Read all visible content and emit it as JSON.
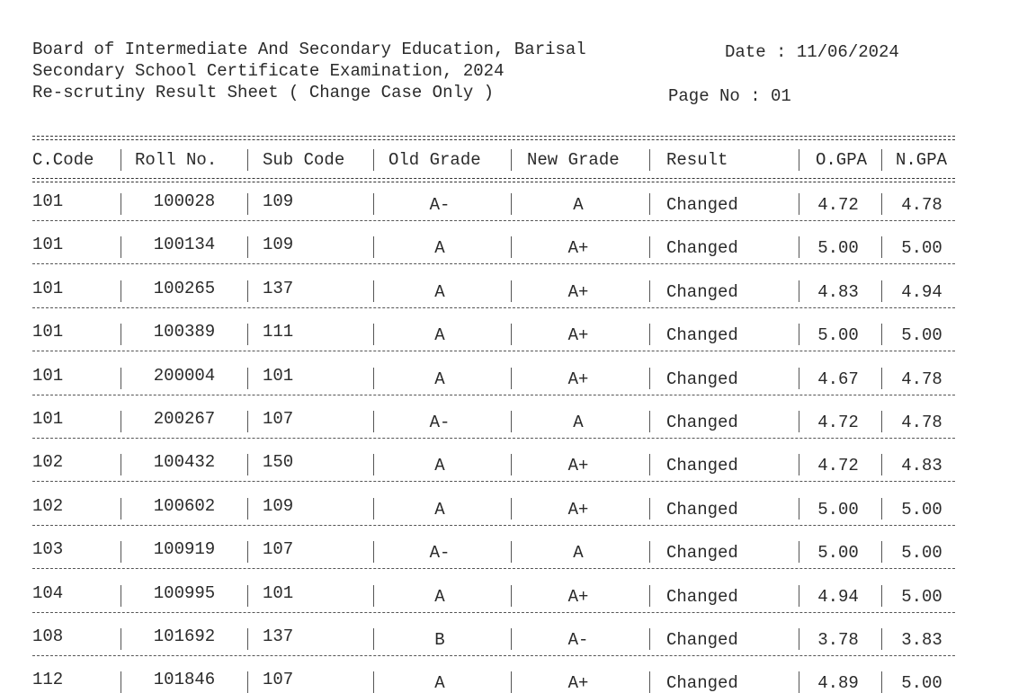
{
  "header": {
    "board": "Board of Intermediate And Secondary Education, Barisal",
    "exam": "Secondary School Certificate Examination, 2024",
    "sheet_title": "Re-scrutiny Result Sheet ( Change Case Only )",
    "date_label": "Date : 11/06/2024",
    "page_label": "Page No : 01"
  },
  "table": {
    "columns": [
      "C.Code",
      "Roll No.",
      "Sub Code",
      "Old Grade",
      "New Grade",
      "Result",
      "O.GPA",
      "N.GPA"
    ],
    "rows": [
      {
        "ccode": "101",
        "roll": "100028",
        "sub": "109",
        "old": "A-",
        "new": "A",
        "result": "Changed",
        "ogpa": "4.72",
        "ngpa": "4.78"
      },
      {
        "ccode": "101",
        "roll": "100134",
        "sub": "109",
        "old": "A",
        "new": "A+",
        "result": "Changed",
        "ogpa": "5.00",
        "ngpa": "5.00"
      },
      {
        "ccode": "101",
        "roll": "100265",
        "sub": "137",
        "old": "A",
        "new": "A+",
        "result": "Changed",
        "ogpa": "4.83",
        "ngpa": "4.94"
      },
      {
        "ccode": "101",
        "roll": "100389",
        "sub": "111",
        "old": "A",
        "new": "A+",
        "result": "Changed",
        "ogpa": "5.00",
        "ngpa": "5.00"
      },
      {
        "ccode": "101",
        "roll": "200004",
        "sub": "101",
        "old": "A",
        "new": "A+",
        "result": "Changed",
        "ogpa": "4.67",
        "ngpa": "4.78"
      },
      {
        "ccode": "101",
        "roll": "200267",
        "sub": "107",
        "old": "A-",
        "new": "A",
        "result": "Changed",
        "ogpa": "4.72",
        "ngpa": "4.78"
      },
      {
        "ccode": "102",
        "roll": "100432",
        "sub": "150",
        "old": "A",
        "new": "A+",
        "result": "Changed",
        "ogpa": "4.72",
        "ngpa": "4.83"
      },
      {
        "ccode": "102",
        "roll": "100602",
        "sub": "109",
        "old": "A",
        "new": "A+",
        "result": "Changed",
        "ogpa": "5.00",
        "ngpa": "5.00"
      },
      {
        "ccode": "103",
        "roll": "100919",
        "sub": "107",
        "old": "A-",
        "new": "A",
        "result": "Changed",
        "ogpa": "5.00",
        "ngpa": "5.00"
      },
      {
        "ccode": "104",
        "roll": "100995",
        "sub": "101",
        "old": "A",
        "new": "A+",
        "result": "Changed",
        "ogpa": "4.94",
        "ngpa": "5.00"
      },
      {
        "ccode": "108",
        "roll": "101692",
        "sub": "137",
        "old": "B",
        "new": "A-",
        "result": "Changed",
        "ogpa": "3.78",
        "ngpa": "3.83"
      },
      {
        "ccode": "112",
        "roll": "101846",
        "sub": "107",
        "old": "A",
        "new": "A+",
        "result": "Changed",
        "ogpa": "4.89",
        "ngpa": "5.00"
      }
    ]
  }
}
